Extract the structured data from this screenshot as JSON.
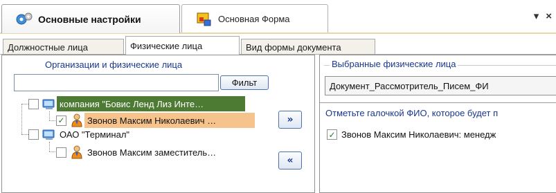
{
  "top_tabs": [
    {
      "label": "Основные настройки",
      "icon": "settings-gear-icon",
      "active": true
    },
    {
      "label": "Основная Форма",
      "icon": "form-icon",
      "active": false
    }
  ],
  "window_controls": {
    "pin": "▾",
    "close": "×"
  },
  "sub_tabs": [
    {
      "label": "Должностные лица",
      "active": false
    },
    {
      "label": "Физические лица",
      "active": true
    },
    {
      "label": "Вид формы документа",
      "active": false
    }
  ],
  "left": {
    "title": "Организации и физические лица",
    "search": {
      "value": "",
      "placeholder": ""
    },
    "filter_button": "Фильт",
    "tree": [
      {
        "label": "компания \"Бовис Ленд Лиз Инте…",
        "type": "organization",
        "checked": false,
        "selected": true
      },
      {
        "label": "Звонов Максим Николаевич …",
        "type": "person",
        "checked": true,
        "selected": true
      },
      {
        "label": "ОАО \"Терминал\"",
        "type": "organization",
        "checked": false,
        "selected": false
      },
      {
        "label": "Звонов Максим  заместитель…",
        "type": "person",
        "checked": false,
        "selected": false
      }
    ],
    "add_button": "»",
    "remove_button": "«"
  },
  "right": {
    "title": "Выбранные физические лица",
    "document_field": "Документ_Рассмотритель_Писем_ФИ",
    "hint": "Отметьте галочкой ФИО, которое будет п",
    "selected_items": [
      {
        "label": "Звонов Максим Николаевич:  менедж",
        "checked": true
      }
    ]
  },
  "colors": {
    "org_selected_bg": "#4d7b34",
    "person_selected_bg": "#f7c38d",
    "title_blue": "#17378e",
    "accent_strip": "#e7d6a8"
  }
}
